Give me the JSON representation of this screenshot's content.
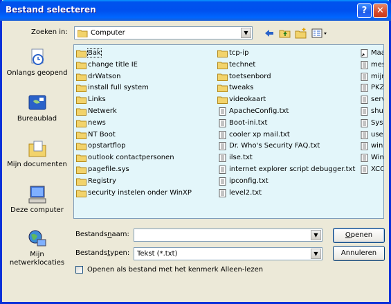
{
  "window": {
    "title": "Bestand selecteren",
    "help_label": "?",
    "close_label": "✕"
  },
  "lookin": {
    "label": "Zoeken in:",
    "value": "Computer"
  },
  "places": [
    {
      "label": "Onlangs geopend",
      "icon": "recent-documents-icon"
    },
    {
      "label": "Bureaublad",
      "icon": "desktop-icon"
    },
    {
      "label": "Mijn documenten",
      "icon": "my-documents-icon"
    },
    {
      "label": "Deze computer",
      "icon": "my-computer-icon"
    },
    {
      "label": "Mijn netwerklocaties",
      "icon": "network-places-icon"
    }
  ],
  "files": {
    "col1": [
      {
        "name": "Bak",
        "type": "folder"
      },
      {
        "name": "change title IE",
        "type": "folder"
      },
      {
        "name": "drWatson",
        "type": "folder"
      },
      {
        "name": "install full system",
        "type": "folder"
      },
      {
        "name": "Links",
        "type": "folder"
      },
      {
        "name": "Netwerk",
        "type": "folder"
      },
      {
        "name": "news",
        "type": "folder"
      },
      {
        "name": "NT Boot",
        "type": "folder"
      },
      {
        "name": "opstartflop",
        "type": "folder"
      },
      {
        "name": "outlook contactpersonen",
        "type": "folder"
      },
      {
        "name": "pagefile.sys",
        "type": "folder"
      },
      {
        "name": "Registry",
        "type": "folder"
      },
      {
        "name": "security instelen onder WinXP",
        "type": "folder"
      }
    ],
    "col2": [
      {
        "name": "tcp-ip",
        "type": "folder"
      },
      {
        "name": "technet",
        "type": "folder"
      },
      {
        "name": "toetsenbord",
        "type": "folder"
      },
      {
        "name": "tweaks",
        "type": "folder"
      },
      {
        "name": "videokaart",
        "type": "folder"
      },
      {
        "name": "ApacheConfig.txt",
        "type": "txt"
      },
      {
        "name": "Boot-ini.txt",
        "type": "txt"
      },
      {
        "name": "cooler xp mail.txt",
        "type": "txt"
      },
      {
        "name": "Dr. Who's Security FAQ.txt",
        "type": "txt"
      },
      {
        "name": "ilse.txt",
        "type": "txt"
      },
      {
        "name": "internet explorer script debugger.txt",
        "type": "txt"
      },
      {
        "name": "ipconfig.txt",
        "type": "txt"
      },
      {
        "name": "level2.txt",
        "type": "txt"
      }
    ],
    "col3": [
      {
        "name": "Maa",
        "type": "shortcut"
      },
      {
        "name": "mes",
        "type": "txt"
      },
      {
        "name": "mijn",
        "type": "txt"
      },
      {
        "name": "PKZ",
        "type": "txt"
      },
      {
        "name": "serv",
        "type": "txt"
      },
      {
        "name": "shut",
        "type": "txt"
      },
      {
        "name": "Sysl",
        "type": "txt"
      },
      {
        "name": "user",
        "type": "txt"
      },
      {
        "name": "win9",
        "type": "txt"
      },
      {
        "name": "Win",
        "type": "txt"
      },
      {
        "name": "XCO",
        "type": "txt"
      }
    ]
  },
  "filename": {
    "label_pre": "Bestands",
    "label_u": "n",
    "label_post": "aam:",
    "value": ""
  },
  "filetype": {
    "label_pre": "Bestands",
    "label_u": "t",
    "label_post": "ypen:",
    "value": "Tekst (*.txt)"
  },
  "buttons": {
    "open_u": "O",
    "open_rest": "penen",
    "cancel": "Annuleren"
  },
  "readonly": {
    "label": "Openen als bestand met het kenmerk Alleen-lezen"
  },
  "colors": {
    "title_blue": "#0054e3",
    "list_bg": "#e3f6fa",
    "folder": "#f2d36b"
  }
}
